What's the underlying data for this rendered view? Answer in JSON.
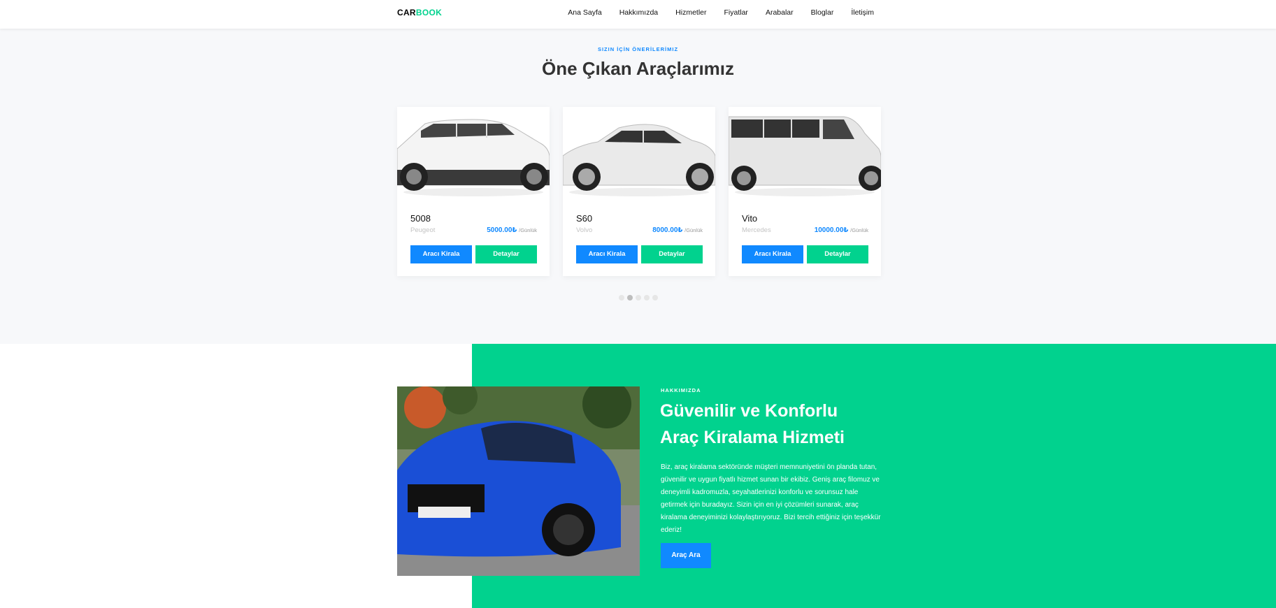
{
  "brand": {
    "part1": "CAR",
    "part2": "BOOK"
  },
  "nav": [
    "Ana Sayfa",
    "Hakkımızda",
    "Hizmetler",
    "Fiyatlar",
    "Arabalar",
    "Bloglar",
    "İletişim"
  ],
  "featured": {
    "subheading": "SIZIN İÇİN ÖNERİLERİMIZ",
    "heading": "Öne Çıkan Araçlarımız",
    "cars": [
      {
        "name": "5008",
        "brand": "Peugeot",
        "price": "5000.00₺",
        "per": "/Günlük",
        "rent_label": "Aracı Kirala",
        "detail_label": "Detaylar"
      },
      {
        "name": "S60",
        "brand": "Volvo",
        "price": "8000.00₺",
        "per": "/Günlük",
        "rent_label": "Aracı Kirala",
        "detail_label": "Detaylar"
      },
      {
        "name": "Vito",
        "brand": "Mercedes",
        "price": "10000.00₺",
        "per": "/Günlük",
        "rent_label": "Aracı Kirala",
        "detail_label": "Detaylar"
      }
    ],
    "carousel": {
      "total": 5,
      "active": 2
    }
  },
  "about": {
    "subheading": "HAKKIMIZDA",
    "title_line1": "Güvenilir ve Konforlu",
    "title_line2": "Araç Kiralama Hizmeti",
    "text": "Biz, araç kiralama sektöründe müşteri memnuniyetini ön planda tutan, güvenilir ve uygun fiyatlı hizmet sunan bir ekibiz. Geniş araç filomuz ve deneyimli kadromuzla, seyahatlerinizi konforlu ve sorunsuz hale getirmek için buradayız. Sizin için en iyi çözümleri sunarak, araç kiralama deneyiminizi kolaylaştırıyoruz. Bizi tercih ettiğiniz için teşekkür ederiz!",
    "button": "Araç Ara"
  },
  "colors": {
    "primary": "#1089ff",
    "accent": "#01d28e",
    "section_bg": "#f7f8fa"
  }
}
